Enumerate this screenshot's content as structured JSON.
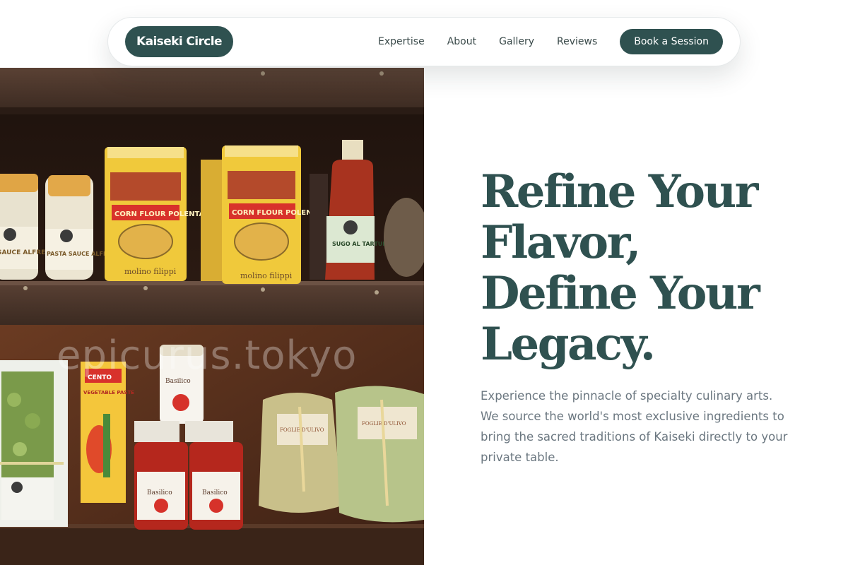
{
  "nav": {
    "brand": "Kaiseki Circle",
    "links": [
      "Expertise",
      "About",
      "Gallery",
      "Reviews"
    ],
    "cta": "Book a Session"
  },
  "hero": {
    "headline_lines": [
      "Refine Your",
      "Flavor,",
      "Define Your",
      "Legacy."
    ],
    "description": "Experience the pinnacle of specialty culinary arts. We source the world's most exclusive ingredients to bring the sacred traditions of Kaiseki directly to your private table."
  },
  "image": {
    "watermark": "epicurus.tokyo",
    "jar_labels": [
      "SAUCE ALFREDO",
      "PASTA SAUCE ALFREDO"
    ],
    "bag_labels": [
      "CORN FLOUR POLENTA",
      "CORN FLOUR POLENTA"
    ],
    "bag_brand": "molino filippi",
    "bottle_label": "SUGO AL TARTUFO",
    "tomato_jar_label": "Basilico",
    "paste_label": "VEGETABLE PASTE",
    "paste_brand": "CENTO",
    "pasta_label": "FOGLIE D'ULIVO"
  },
  "colors": {
    "primary": "#2f5150",
    "text_muted": "#6b7780",
    "nav_text": "#3a4a4a"
  }
}
